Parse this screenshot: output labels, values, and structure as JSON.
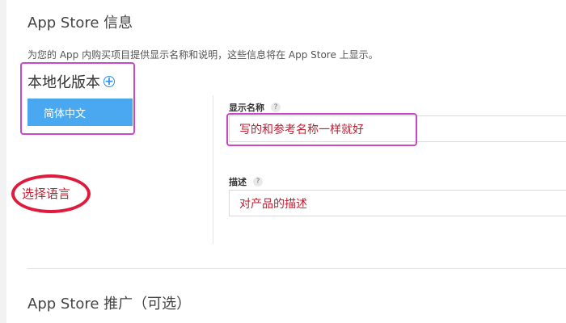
{
  "section": {
    "title": "App Store 信息",
    "description": "为您的 App 内购买项目提供显示名称和说明，这些信息将在 App Store 上显示。"
  },
  "localization": {
    "title": "本地化版本",
    "add_icon": "plus-circle-icon",
    "languages": [
      "简体中文"
    ],
    "selected": "简体中文"
  },
  "fields": {
    "display_name": {
      "label": "显示名称",
      "help": "?",
      "value": "写的和参考名称一样就好"
    },
    "description": {
      "label": "描述",
      "help": "?",
      "value": "对产品的描述"
    }
  },
  "annotations": {
    "choose_language": "选择语言"
  },
  "promo": {
    "title": "App Store 推广（可选）"
  },
  "colors": {
    "accent_blue": "#4aa8f0",
    "annotation_purple": "#c848c8",
    "annotation_red": "#e01a3c"
  }
}
